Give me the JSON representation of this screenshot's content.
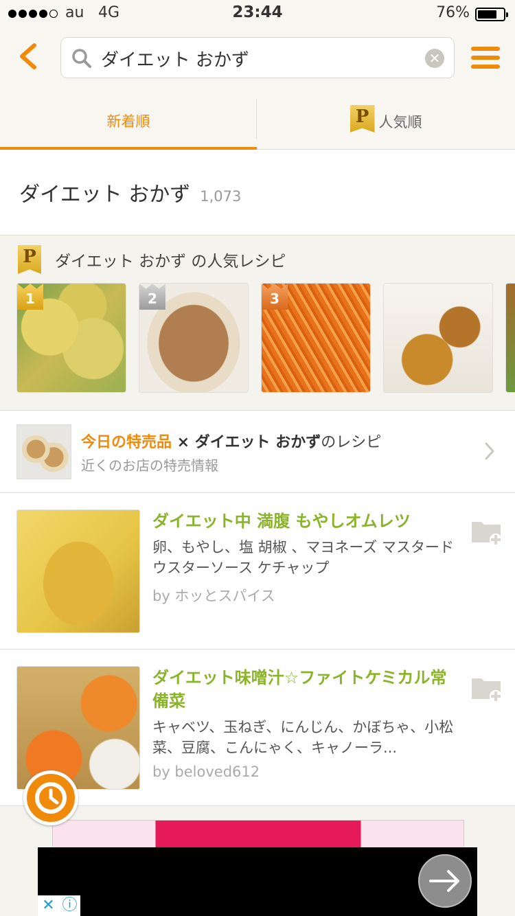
{
  "status": {
    "carrier": "au",
    "network": "4G",
    "time": "23:44",
    "battery": "76%",
    "battery_level": 0.76
  },
  "search": {
    "query": "ダイエット おかず"
  },
  "tabs": [
    {
      "label": "新着順",
      "active": true
    },
    {
      "label": "人気順",
      "badge": "P",
      "active": false
    }
  ],
  "result": {
    "title": "ダイエット おかず",
    "count": "1,073"
  },
  "popular": {
    "badge": "P",
    "heading": "ダイエット おかず の人気レシピ",
    "items": [
      {
        "rank": "1"
      },
      {
        "rank": "2"
      },
      {
        "rank": "3"
      },
      {
        "rank": ""
      },
      {
        "rank": ""
      }
    ]
  },
  "sale": {
    "highlight": "今日の特売品",
    "times": " × ",
    "keyword": "ダイエット おかず",
    "suffix": "のレシピ",
    "sub": "近くのお店の特売情報"
  },
  "recipes": [
    {
      "title": "ダイエット中 満腹 もやしオムレツ",
      "ingredients": "卵、もやし、塩 胡椒 、マヨネーズ マスタード ウスターソース ケチャップ",
      "author": "by ホッとスパイス"
    },
    {
      "title": "ダイエット味噌汁☆ファイトケミカル常備菜",
      "ingredients": "キャベツ、玉ねぎ、にんじん、かぼちゃ、小松菜、豆腐、こんにゃく、キャノーラ...",
      "author": "by beloved612"
    }
  ],
  "colors": {
    "accent": "#f08a0b",
    "title_green": "#8ab428"
  },
  "icons": {
    "back": "chevron-left-icon",
    "search": "search-icon",
    "clear": "clear-icon",
    "menu": "hamburger-menu-icon",
    "folder": "folder-add-icon",
    "clock": "clock-icon",
    "next": "arrow-right-icon"
  }
}
